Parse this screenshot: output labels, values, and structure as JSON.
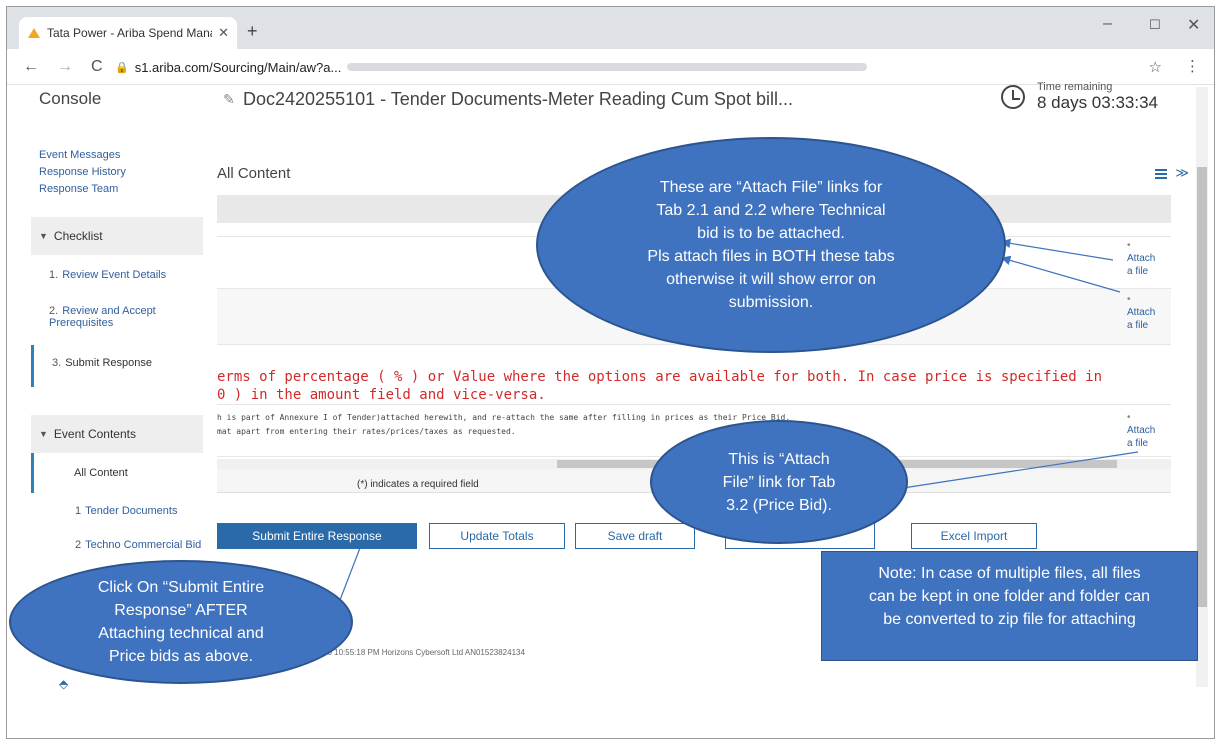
{
  "browser": {
    "tab_title": "Tata Power - Ariba Spend Manag",
    "tab_close": "✕",
    "new_tab": "+",
    "url": "s1.ariba.com/Sourcing/Main/aw?a...",
    "back": "←",
    "forward": "→",
    "reload": "C",
    "minimize": "–",
    "maximize": "☐",
    "close": "✕"
  },
  "header": {
    "console": "Console",
    "doc_title": "Doc2420255101 - Tender Documents-Meter Reading Cum Spot bill...",
    "time_label": "Time remaining",
    "time_value": "8 days 03:33:34"
  },
  "sidebar": {
    "links": [
      "Event Messages",
      "Response History",
      "Response Team"
    ],
    "checklist_title": "Checklist",
    "checklist": [
      {
        "num": "1.",
        "label": "Review Event Details"
      },
      {
        "num": "2.",
        "label": "Review and Accept Prerequisites"
      },
      {
        "num": "3.",
        "label": "Submit Response"
      }
    ],
    "event_contents_title": "Event Contents",
    "event_contents": [
      {
        "num": "",
        "label": "All Content"
      },
      {
        "num": "1",
        "label": "Tender Documents"
      },
      {
        "num": "2",
        "label": "Techno Commercial Bid"
      }
    ]
  },
  "content": {
    "title": "All Content",
    "attach_label_1": "Attach",
    "attach_label_2": "a file",
    "attach_dot": "•",
    "red_line_1": "erms of percentage ( % ) or Value where the options are available for both. In case price is specified in",
    "red_line_2": "0 ) in the amount field and vice-versa.",
    "small_line_1": "h is part of Annexure I of Tender)attached herewith, and re-attach the same after filling in prices as their Price Bid.",
    "small_line_2": "mat apart from entering their rates/prices/taxes as requested.",
    "required_note": "(*) indicates a required field",
    "footer_text": "20 10:55:18 PM  Horizons Cybersoft Ltd  AN01523824134"
  },
  "buttons": {
    "submit": "Submit Entire Response",
    "update": "Update Totals",
    "save": "Save draft",
    "excel": "Excel Import"
  },
  "callouts": {
    "technical": [
      "These are “Attach File” links for",
      "Tab 2.1 and 2.2 where Technical",
      "bid is to be attached.",
      "Pls attach files in BOTH these tabs",
      "otherwise it will show error on",
      "submission."
    ],
    "price": [
      "This is “Attach",
      "File” link for Tab",
      "3.2 (Price Bid)."
    ],
    "submit": [
      "Click On “Submit Entire",
      "Response” AFTER",
      "Attaching technical and",
      "Price bids as above."
    ],
    "note": [
      "Note: In case of multiple files, all files",
      "can be kept in one folder and folder can",
      "be converted to zip file for attaching"
    ]
  },
  "colors": {
    "callout_fill": "#3f72bf",
    "accent": "#2a6aa8",
    "warning_text": "#d22a2a"
  }
}
